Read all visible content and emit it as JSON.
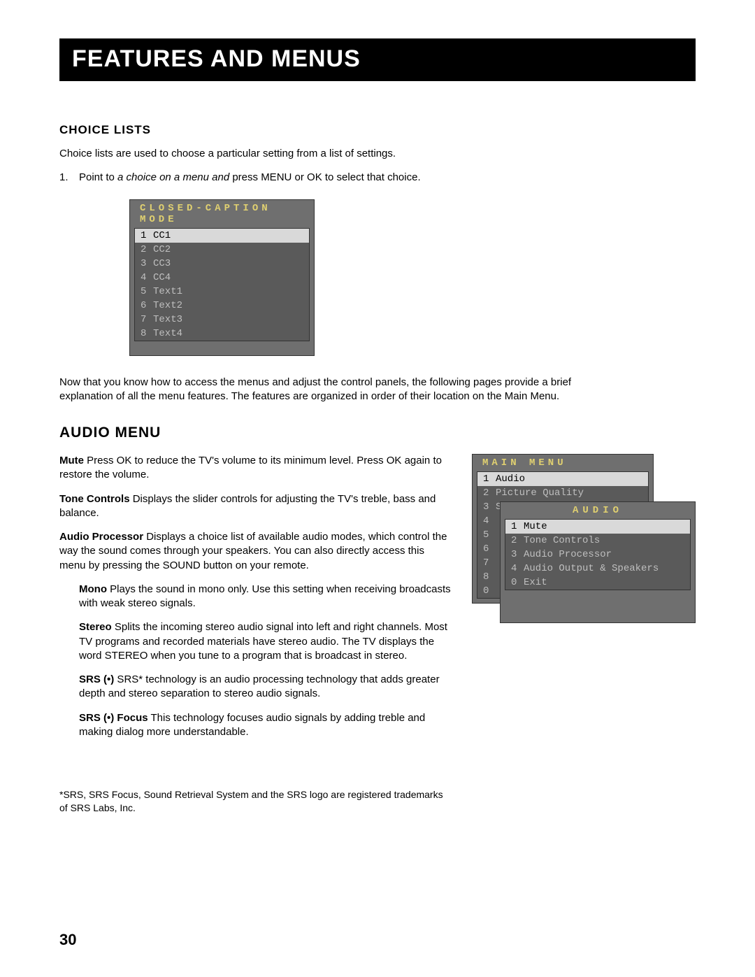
{
  "header": "FEATURES AND MENUS",
  "choice": {
    "heading": "CHOICE LISTS",
    "intro": "Choice lists are used to choose a particular setting from a list of settings.",
    "step_num": "1.",
    "step_prefix": "Point to ",
    "step_italic": "a choice on a menu and ",
    "step_suffix": "press MENU or OK to select that choice.",
    "cc_title": "CLOSED-CAPTION MODE",
    "cc_items": [
      {
        "n": "1",
        "label": "CC1",
        "sel": true
      },
      {
        "n": "2",
        "label": "CC2"
      },
      {
        "n": "3",
        "label": "CC3"
      },
      {
        "n": "4",
        "label": "CC4"
      },
      {
        "n": "5",
        "label": "Text1"
      },
      {
        "n": "6",
        "label": "Text2"
      },
      {
        "n": "7",
        "label": "Text3"
      },
      {
        "n": "8",
        "label": "Text4"
      }
    ],
    "after": "Now that you know how to access the menus and adjust the control panels, the following pages provide a brief explanation of all the menu features. The features are organized in order of their location on the Main Menu."
  },
  "audio": {
    "heading": "AUDIO MENU",
    "mute_label": "Mute",
    "mute_text": "  Press OK to reduce the TV's volume to its minimum level. Press OK again to restore the volume.",
    "tone_label": "Tone Controls",
    "tone_text": "  Displays the slider controls for adjusting the TV's treble, bass and balance.",
    "proc_label": "Audio Processor",
    "proc_text": "  Displays a choice list of available audio modes, which control the way the sound comes through your speakers. You can also directly access this menu by pressing the SOUND button on your remote.",
    "mono_label": "Mono",
    "mono_text": "   Plays the sound in mono only. Use this setting when receiving broadcasts with weak stereo signals.",
    "stereo_label": "Stereo",
    "stereo_text": "   Splits the incoming stereo audio signal into left and right channels. Most TV programs and recorded materials have stereo audio. The TV displays the word STEREO when you tune to a program that is broadcast in stereo.",
    "srs_label": "SRS (•)",
    "srs_text": "  SRS* technology is an audio processing technology that adds greater depth and stereo separation to stereo audio signals.",
    "srsfocus_label": "SRS (•) Focus",
    "srsfocus_text": "  This technology focuses audio signals by adding treble and making dialog more understandable.",
    "main_title": "MAIN MENU",
    "main_items": [
      {
        "n": "1",
        "label": "Audio",
        "sel": true
      },
      {
        "n": "2",
        "label": "Picture Quality"
      },
      {
        "n": "3",
        "label": "Screen"
      },
      {
        "n": "4",
        "label": ""
      },
      {
        "n": "5",
        "label": ""
      },
      {
        "n": "6",
        "label": ""
      },
      {
        "n": "7",
        "label": ""
      },
      {
        "n": "8",
        "label": ""
      },
      {
        "n": "0",
        "label": ""
      }
    ],
    "sub_title": "AUDIO",
    "sub_items": [
      {
        "n": "1",
        "label": "Mute",
        "sel": true
      },
      {
        "n": "2",
        "label": "Tone Controls"
      },
      {
        "n": "3",
        "label": "Audio Processor"
      },
      {
        "n": "4",
        "label": "Audio Output & Speakers"
      },
      {
        "n": "0",
        "label": "Exit"
      }
    ]
  },
  "footnote": "*SRS, SRS Focus, Sound Retrieval System and the SRS logo are registered trademarks of SRS Labs, Inc.",
  "page_number": "30"
}
